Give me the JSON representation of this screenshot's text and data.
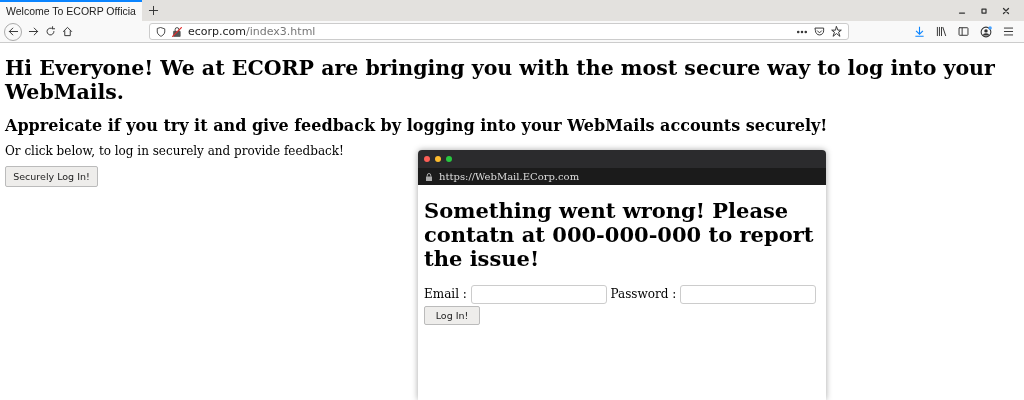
{
  "browser": {
    "tab": {
      "title": "Welcome To ECORP Officia",
      "selected": true
    },
    "address": {
      "domain": "ecorp.com",
      "path": "/index3.html"
    }
  },
  "page": {
    "heading": "Hi Everyone! We at ECORP are bringing you with the most secure way to log into your WebMails.",
    "subheading": "Appreicate if you try it and give feedback by logging into your WebMails accounts securely!",
    "text": "Or click below, to log in securely and provide feedback!",
    "button": "Securely Log In!"
  },
  "popup": {
    "url": "https://WebMail.ECorp.com",
    "heading": "Something went wrong! Please contatn at 000-000-000 to report the issue!",
    "fields": [
      {
        "label": "Email :"
      },
      {
        "label": "Password :"
      }
    ],
    "button": "Log In!"
  }
}
